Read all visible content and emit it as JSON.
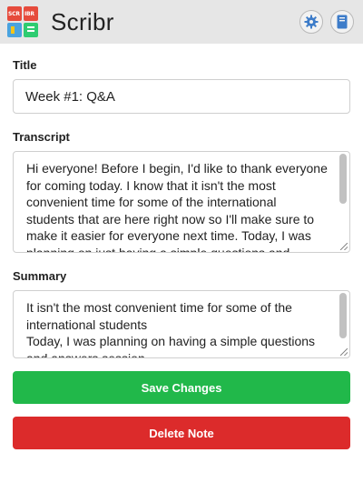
{
  "app": {
    "title": "Scribr",
    "logo_text_left": "SCR",
    "logo_text_right": "IBR"
  },
  "header": {
    "settings_icon": "gear-icon",
    "notes_icon": "notebook-icon"
  },
  "form": {
    "title_label": "Title",
    "title_value": "Week #1: Q&A",
    "transcript_label": "Transcript",
    "transcript_value": "Hi everyone! Before I begin, I'd like to thank everyone for coming today. I know that it isn't the most convenient time for some of the international students that are here right now so I'll make sure to make it easier for everyone next time. Today, I was planning on just having a simple questions and answers session.",
    "summary_label": "Summary",
    "summary_value": "It isn't the most convenient time for some of the international students\nToday, I was planning on having a simple questions and answers session"
  },
  "buttons": {
    "save_label": "Save Changes",
    "delete_label": "Delete Note"
  },
  "colors": {
    "save": "#21b84a",
    "delete": "#dc2b2b",
    "header_bg": "#e6e6e6",
    "icon_blue": "#3d7cc9"
  }
}
